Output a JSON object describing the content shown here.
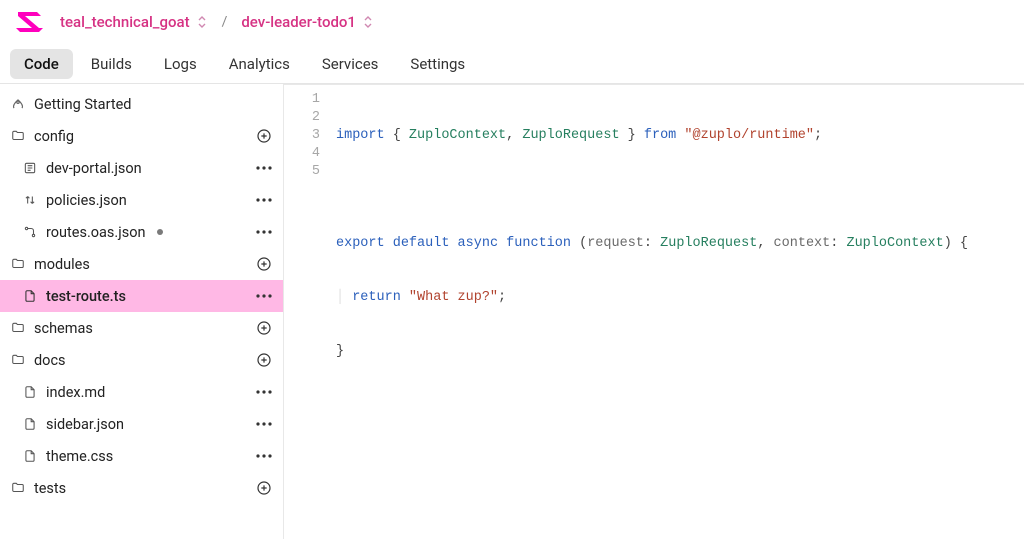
{
  "breadcrumb": {
    "org": "teal_technical_goat",
    "project": "dev-leader-todo1"
  },
  "tabs": {
    "code": "Code",
    "builds": "Builds",
    "logs": "Logs",
    "analytics": "Analytics",
    "services": "Services",
    "settings": "Settings",
    "active": "code"
  },
  "sidebar": {
    "getting_started": "Getting Started",
    "config": {
      "label": "config",
      "items": {
        "dev_portal": "dev-portal.json",
        "policies": "policies.json",
        "routes": "routes.oas.json"
      }
    },
    "modules": {
      "label": "modules",
      "items": {
        "test_route": "test-route.ts"
      }
    },
    "schemas": {
      "label": "schemas"
    },
    "docs": {
      "label": "docs",
      "items": {
        "index": "index.md",
        "sidebar": "sidebar.json",
        "theme": "theme.css"
      }
    },
    "tests": {
      "label": "tests"
    }
  },
  "editor": {
    "line_numbers": [
      "1",
      "2",
      "3",
      "4",
      "5"
    ],
    "code": {
      "l1": {
        "kw1": "import",
        "punct1": " { ",
        "t1": "ZuploContext",
        "sep": ", ",
        "t2": "ZuploRequest",
        "punct2": " } ",
        "kw2": "from",
        "sp": " ",
        "str": "\"@zuplo/runtime\"",
        "end": ";"
      },
      "l3": {
        "kw1": "export",
        "sp1": " ",
        "kw2": "default",
        "sp2": " ",
        "kw3": "async",
        "sp3": " ",
        "kw4": "function",
        "sp4": " ",
        "p1": "(",
        "id1": "request",
        "c1": ": ",
        "t1": "ZuploRequest",
        "sep": ", ",
        "id2": "context",
        "c2": ": ",
        "t2": "ZuploContext",
        "p2": ")",
        "sp5": " ",
        "br": "{"
      },
      "l4": {
        "indent": "  ",
        "kw": "return",
        "sp": " ",
        "str": "\"What zup?\"",
        "end": ";"
      },
      "l5": {
        "br": "}"
      }
    }
  }
}
